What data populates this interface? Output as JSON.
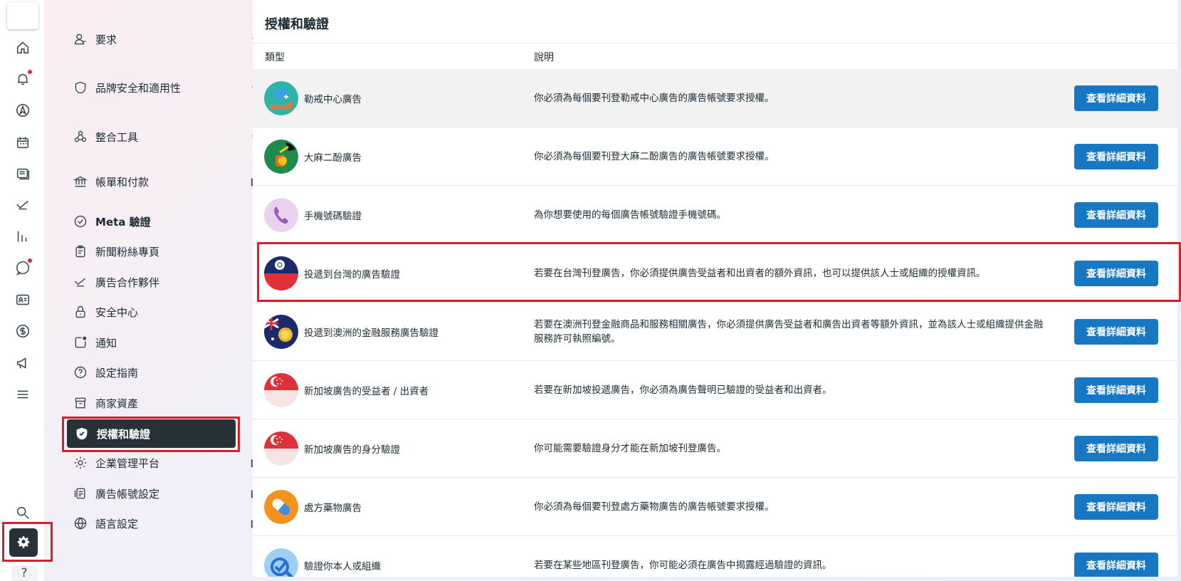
{
  "rail": {
    "items": [
      {
        "name": "home-icon"
      },
      {
        "name": "notifications-icon",
        "badge": true
      },
      {
        "name": "navigation-icon"
      },
      {
        "name": "calendar-icon"
      },
      {
        "name": "pages-icon"
      },
      {
        "name": "partners-icon"
      },
      {
        "name": "analytics-icon"
      },
      {
        "name": "messages-icon",
        "badge": true
      },
      {
        "name": "contacts-card-icon"
      },
      {
        "name": "billing-dollar-icon"
      },
      {
        "name": "megaphone-icon"
      },
      {
        "name": "menu-icon"
      }
    ],
    "search_icon": "search-icon",
    "settings_icon": "gear-icon",
    "help_label": "?"
  },
  "nav": {
    "items": [
      {
        "label": "要求",
        "icon": "person-icon",
        "right": "chevron-down"
      },
      {
        "label": "品牌安全和適用性",
        "icon": "shield-icon",
        "right": "chevron-down"
      },
      {
        "label": "整合工具",
        "icon": "integrations-icon",
        "right": "chevron-down"
      },
      {
        "label": "帳單和付款",
        "icon": "bank-icon",
        "right": "external-link"
      },
      {
        "label": "Meta 驗證",
        "icon": "verified-badge-icon",
        "bold": true
      },
      {
        "label": "新聞粉絲專頁",
        "icon": "clipboard-icon"
      },
      {
        "label": "廣告合作夥伴",
        "icon": "partners-icon"
      },
      {
        "label": "安全中心",
        "icon": "lock-icon"
      },
      {
        "label": "通知",
        "icon": "notification-icon"
      },
      {
        "label": "設定指南",
        "icon": "help-circle-icon"
      },
      {
        "label": "商家資產",
        "icon": "archive-icon"
      },
      {
        "label": "授權和驗證",
        "icon": "shield-check-icon",
        "active": true
      },
      {
        "label": "企業管理平台",
        "icon": "gear-icon",
        "right": "external-link"
      },
      {
        "label": "廣告帳號設定",
        "icon": "ad-account-icon",
        "right": "external-link"
      },
      {
        "label": "語言設定",
        "icon": "globe-icon",
        "right": "external-link"
      }
    ]
  },
  "main": {
    "title": "授權和驗證",
    "col_type": "類型",
    "col_desc": "說明",
    "button_label": "查看詳細資料",
    "rows": [
      {
        "name": "勒戒中心廣告",
        "desc": "你必須為每個要刊登勒戒中心廣告的廣告帳號要求授權。",
        "icon": "rehab-center-icon",
        "icon_color": "#2bb5a8"
      },
      {
        "name": "大麻二酚廣告",
        "desc": "你必須為每個要刊登大麻二酚廣告的廣告帳號要求授權。",
        "icon": "cbd-icon",
        "icon_color": "#1e8a4c"
      },
      {
        "name": "手機號碼驗證",
        "desc": "為你想要使用的每個廣告帳號驗證手機號碼。",
        "icon": "phone-icon",
        "icon_color": "#e8d3ee"
      },
      {
        "name": "投遞到台灣的廣告驗證",
        "desc": "若要在台灣刊登廣告，你必須提供廣告受益者和出資者的額外資訊，也可以提供該人士或組織的授權資訊。",
        "icon": "taiwan-flag-icon",
        "icon_color": "#e0313a"
      },
      {
        "name": "投遞到澳洲的金融服務廣告驗證",
        "desc": "若要在澳洲刊登金融商品和服務相關廣告，你必須提供廣告受益者和廣告出資者等額外資訊，並為該人士或組織提供金融服務許可執照編號。",
        "icon": "australia-flag-icon",
        "icon_color": "#1a2a6c"
      },
      {
        "name": "新加坡廣告的受益者 / 出資者",
        "desc": "若要在新加坡投遞廣告，你必須為廣告聲明已驗證的受益者和出資者。",
        "icon": "singapore-flag-icon",
        "icon_color": "#e0313a"
      },
      {
        "name": "新加坡廣告的身分驗證",
        "desc": "你可能需要驗證身分才能在新加坡刊登廣告。",
        "icon": "singapore-flag-icon",
        "icon_color": "#e0313a"
      },
      {
        "name": "處方藥物廣告",
        "desc": "你必須為每個要刊登處方藥物廣告的廣告帳號要求授權。",
        "icon": "pill-icon",
        "icon_color": "#f5921e"
      },
      {
        "name": "驗證你本人或組織",
        "desc": "若要在某些地區刊登廣告，你可能必須在廣告中揭露經過驗證的資訊。",
        "icon": "verify-identity-icon",
        "icon_color": "#9fd0f2"
      }
    ]
  }
}
